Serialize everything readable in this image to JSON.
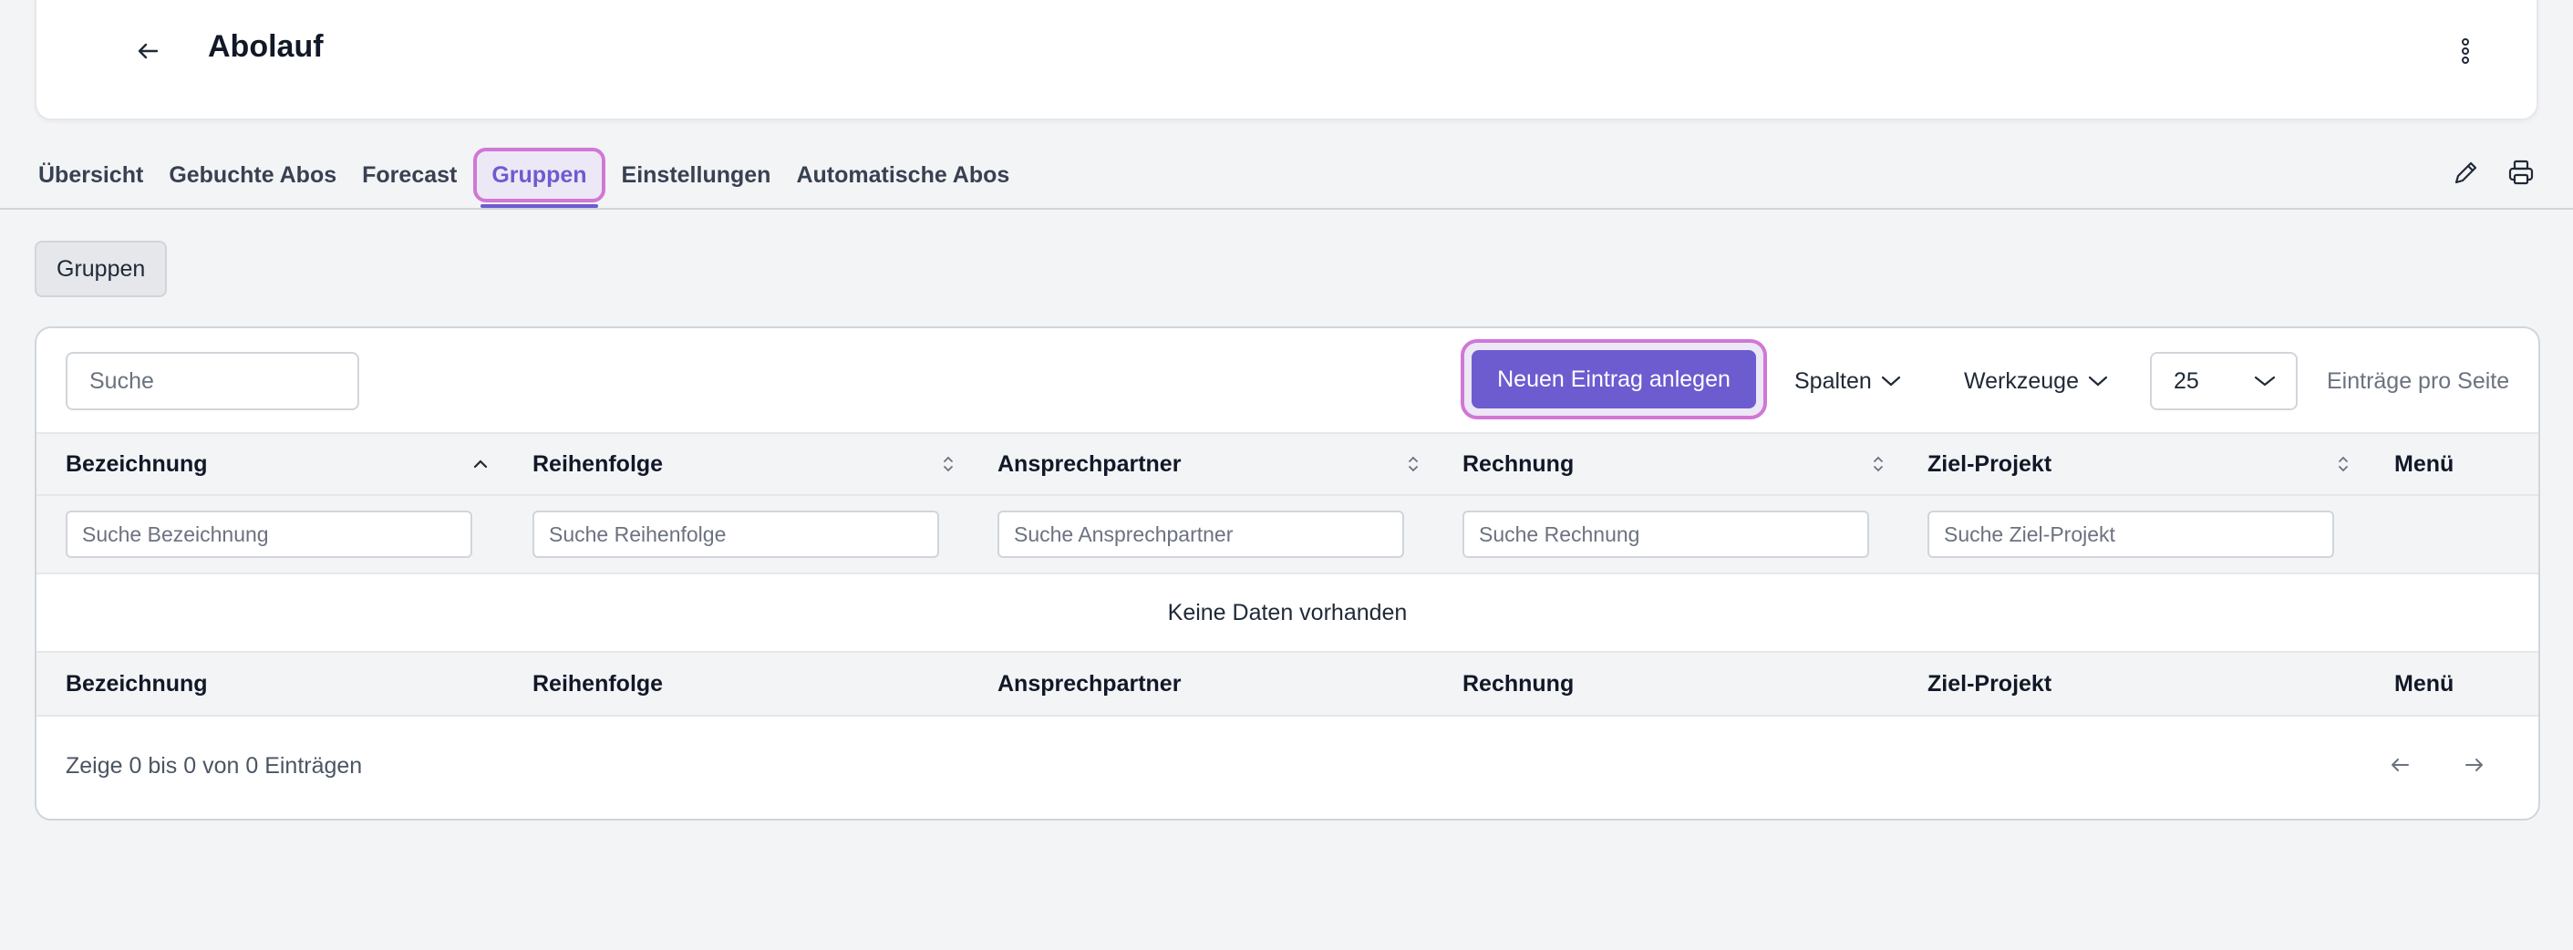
{
  "header": {
    "title": "Abolauf",
    "back_icon": "arrow-left-icon",
    "menu_icon": "kebab-menu-icon"
  },
  "tabs": [
    {
      "label": "Übersicht",
      "active": false
    },
    {
      "label": "Gebuchte Abos",
      "active": false
    },
    {
      "label": "Forecast",
      "active": false
    },
    {
      "label": "Gruppen",
      "active": true
    },
    {
      "label": "Einstellungen",
      "active": false
    },
    {
      "label": "Automatische Abos",
      "active": false
    }
  ],
  "tab_tools": {
    "edit_icon": "pencil-icon",
    "print_icon": "printer-icon"
  },
  "section_chip": "Gruppen",
  "toolbar": {
    "search_placeholder": "Suche",
    "new_button": "Neuen Eintrag anlegen",
    "columns_label": "Spalten",
    "tools_label": "Werkzeuge",
    "page_size": "25",
    "per_page_label": "Einträge pro Seite"
  },
  "table": {
    "columns": [
      {
        "label": "Bezeichnung",
        "filter_placeholder": "Suche Bezeichnung",
        "sort": "asc"
      },
      {
        "label": "Reihenfolge",
        "filter_placeholder": "Suche Reihenfolge",
        "sort": "none"
      },
      {
        "label": "Ansprechpartner",
        "filter_placeholder": "Suche Ansprechpartner",
        "sort": "none"
      },
      {
        "label": "Rechnung",
        "filter_placeholder": "Suche Rechnung",
        "sort": "none"
      },
      {
        "label": "Ziel-Projekt",
        "filter_placeholder": "Suche Ziel-Projekt",
        "sort": "none"
      },
      {
        "label": "Menü"
      }
    ],
    "empty_text": "Keine Daten vorhanden",
    "summary": "Zeige 0 bis 0 von 0 Einträgen"
  },
  "colors": {
    "accent": "#6d5bd0",
    "highlight_border": "#d177d6",
    "highlight_fill": "#ece8f6"
  }
}
